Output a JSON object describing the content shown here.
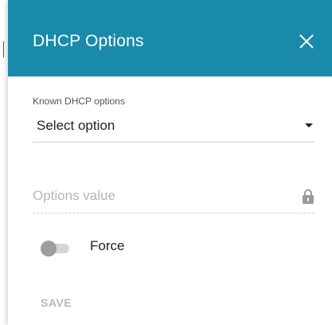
{
  "dialog": {
    "title": "DHCP Options",
    "close_icon": "close-icon"
  },
  "known_options": {
    "label": "Known DHCP options",
    "selected": "Select option",
    "caret_icon": "chevron-down-icon"
  },
  "options_value": {
    "placeholder": "Options value",
    "value": "",
    "lock_icon": "lock-icon"
  },
  "force": {
    "label": "Force",
    "enabled": false
  },
  "actions": {
    "save_label": "SAVE"
  },
  "colors": {
    "header_bg": "#1a8aaa",
    "header_text": "#ffffff",
    "disabled_text": "#b8b8b8",
    "toggle_knob_off": "#9e9e9e",
    "toggle_track_off": "#d6d6d6"
  }
}
